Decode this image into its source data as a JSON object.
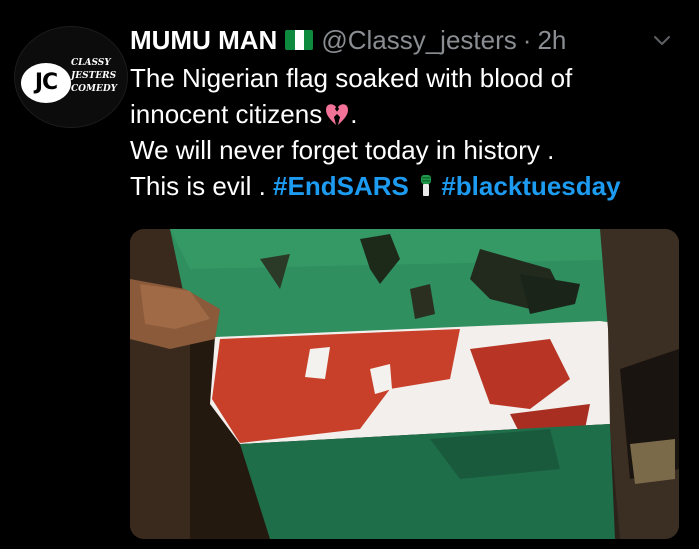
{
  "tweet": {
    "avatar": {
      "logo_text": "JC",
      "words": [
        "CLASSY",
        "JESTERS",
        "COMEDY"
      ]
    },
    "author": {
      "display_name": "MUMU MAN",
      "handle": "@Classy_jesters",
      "separator": "·",
      "time": "2h"
    },
    "text": {
      "line1": "The Nigerian flag soaked with blood of",
      "line2": "innocent citizens",
      "line3": "We will never forget today in history .",
      "line4_prefix": "This is evil .",
      "hashtags": [
        "#EndSARS",
        "#blacktuesday"
      ]
    },
    "icons": {
      "flag": "nigeria-flag-icon",
      "heart": "broken-heart-icon",
      "fist": "raised-fist-icon",
      "menu": "chevron-down-icon"
    },
    "colors": {
      "background": "#000000",
      "text": "#ffffff",
      "secondary": "#8a8d91",
      "link": "#1d9bf0",
      "heart": "#f27397"
    }
  }
}
